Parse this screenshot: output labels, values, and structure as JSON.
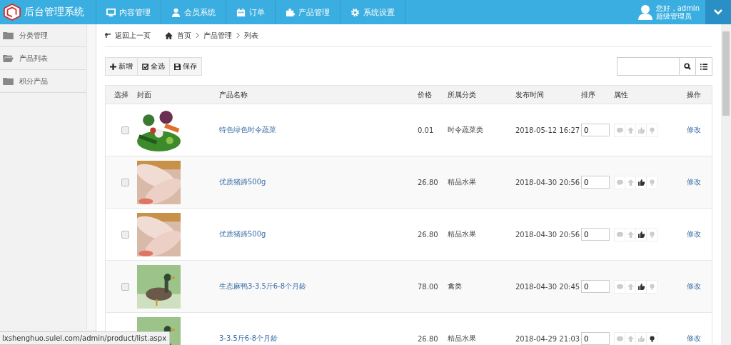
{
  "header": {
    "title": "后台管理系统",
    "nav": [
      {
        "label": "内容管理"
      },
      {
        "label": "会员系统"
      },
      {
        "label": "订单"
      },
      {
        "label": "产品管理"
      },
      {
        "label": "系统设置"
      }
    ],
    "user": {
      "greeting": "您好，admin",
      "role": "超级管理员"
    }
  },
  "sidebar": {
    "items": [
      {
        "label": "分类管理",
        "selected": false
      },
      {
        "label": "产品列表",
        "selected": true
      },
      {
        "label": "积分产品",
        "selected": false
      }
    ]
  },
  "breadcrumb": {
    "back": "返回上一页",
    "items": [
      "首页",
      "产品管理",
      "列表"
    ]
  },
  "toolbar": {
    "buttons": [
      {
        "label": "新增"
      },
      {
        "label": "全选"
      },
      {
        "label": "保存"
      }
    ]
  },
  "table": {
    "columns": [
      "选择",
      "封面",
      "产品名称",
      "价格",
      "所属分类",
      "发布时间",
      "排序",
      "属性",
      "操作"
    ],
    "rows": [
      {
        "checked": false,
        "name": "特色绿色时令蔬菜",
        "price": "0.01",
        "category": "时令蔬菜类",
        "time": "2018-05-12 16:27",
        "order": "0",
        "comment": false,
        "top": false,
        "recommend": false,
        "hot": false,
        "action": "修改"
      },
      {
        "checked": false,
        "name": "优质猪蹄500g",
        "price": "26.80",
        "category": "精品水果",
        "time": "2018-04-30 20:56",
        "order": "0",
        "comment": false,
        "top": false,
        "recommend": true,
        "hot": false,
        "action": "修改"
      },
      {
        "checked": false,
        "name": "优质猪蹄500g",
        "price": "26.80",
        "category": "精品水果",
        "time": "2018-04-30 20:56",
        "order": "0",
        "comment": false,
        "top": false,
        "recommend": true,
        "hot": false,
        "action": "修改"
      },
      {
        "checked": false,
        "name": "生态麻鸭3-3.5斤6-8个月龄",
        "price": "78.00",
        "category": "禽类",
        "time": "2018-04-30 20:45",
        "order": "0",
        "comment": false,
        "top": false,
        "recommend": true,
        "hot": false,
        "action": "修改"
      },
      {
        "name": "3-3.5斤6-8个月龄",
        "price": "26.80",
        "category": "精品水果",
        "time": "2018-04-29 21:03",
        "order": "0",
        "comment": false,
        "top": false,
        "recommend": false,
        "hot": true,
        "action": "修改"
      }
    ]
  },
  "status_bar": {
    "url": "lxshenghuo.sulel.com/admin/product/list.aspx"
  }
}
